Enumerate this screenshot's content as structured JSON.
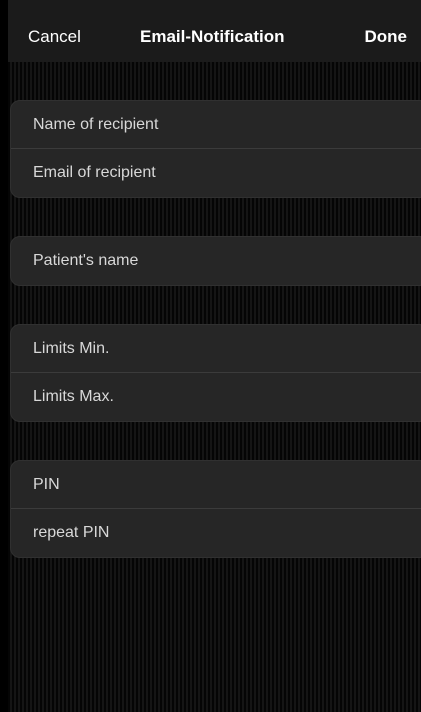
{
  "navbar": {
    "cancel_label": "Cancel",
    "title": "Email-Notification",
    "done_label": "Done"
  },
  "sections": [
    {
      "fields": [
        {
          "placeholder": "Name of recipient",
          "value": ""
        },
        {
          "placeholder": "Email of recipient",
          "value": ""
        }
      ]
    },
    {
      "fields": [
        {
          "placeholder": "Patient's name",
          "value": ""
        }
      ]
    },
    {
      "fields": [
        {
          "placeholder": "Limits Min.",
          "value": ""
        },
        {
          "placeholder": "Limits Max.",
          "value": ""
        }
      ]
    },
    {
      "fields": [
        {
          "placeholder": "PIN",
          "value": ""
        },
        {
          "placeholder": "repeat PIN",
          "value": ""
        }
      ]
    }
  ],
  "colors": {
    "background": "#000000",
    "navbar": "#1b1b1b",
    "group": "#262626",
    "text": "#ffffff",
    "placeholder": "#d8d8d8"
  }
}
